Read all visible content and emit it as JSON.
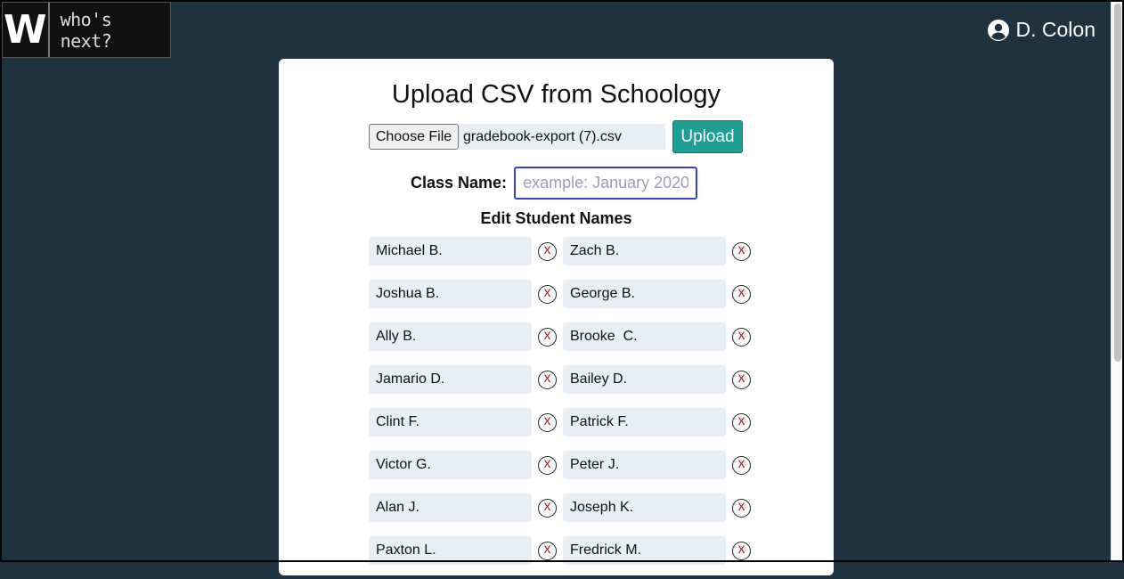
{
  "logo": {
    "letter": "W",
    "tagline": "who's next?"
  },
  "user": {
    "name": "D. Colon",
    "icon": "user-circle-icon"
  },
  "card": {
    "title": "Upload CSV from Schoology",
    "choose_file_label": "Choose File",
    "file_name": "gradebook-export (7).csv",
    "upload_label": "Upload",
    "class_name_label": "Class Name:",
    "class_name_placeholder": "example: January 2020",
    "class_name_value": "",
    "edit_heading": "Edit Student Names",
    "delete_label": "x",
    "students": [
      [
        "Michael B.",
        "Zach B."
      ],
      [
        "Joshua B.",
        "George B."
      ],
      [
        "Ally B.",
        "Brooke  C."
      ],
      [
        "Jamario D.",
        "Bailey D."
      ],
      [
        "Clint F.",
        "Patrick F."
      ],
      [
        "Victor G.",
        "Peter J."
      ],
      [
        "Alan J.",
        "Joseph K."
      ],
      [
        "Paxton L.",
        "Fredrick M."
      ]
    ]
  },
  "colors": {
    "background": "#1e3240",
    "upload_button": "#1e9e94",
    "delete_x": "#b32020",
    "name_field": "#e8eef5"
  }
}
